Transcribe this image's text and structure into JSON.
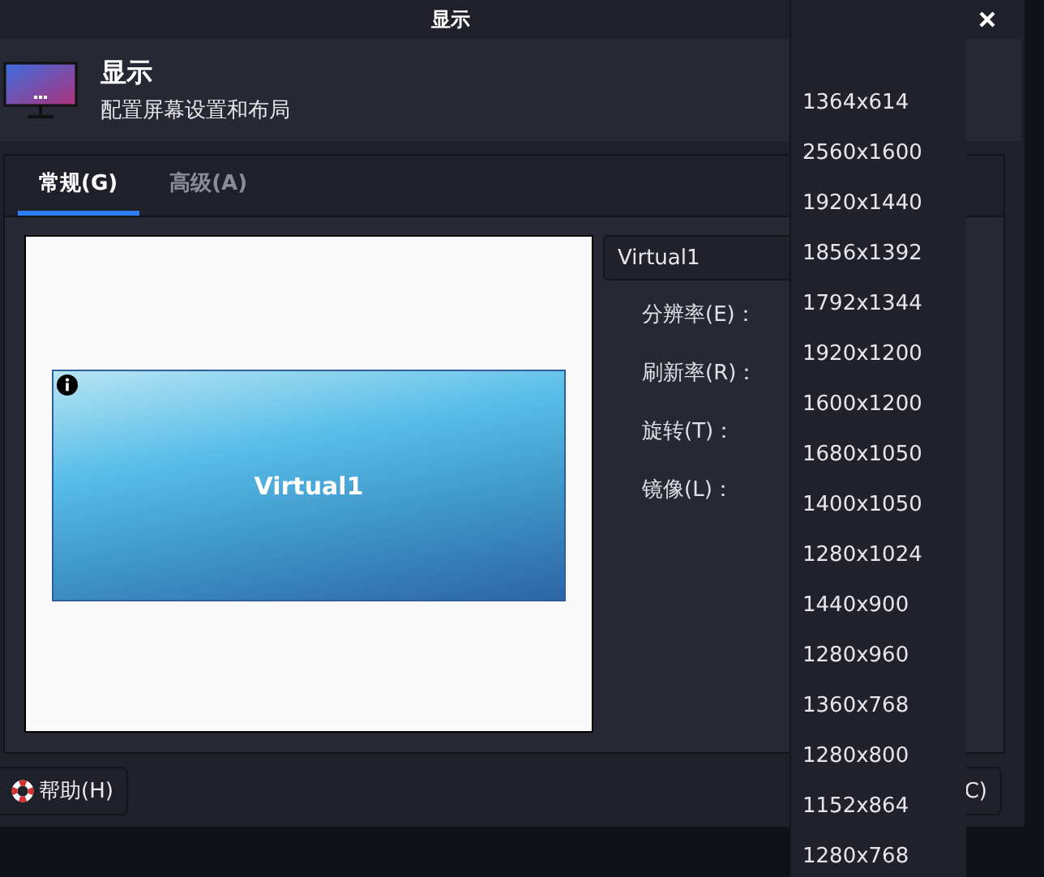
{
  "window": {
    "title": "显示"
  },
  "header": {
    "title": "显示",
    "subtitle": "配置屏幕设置和布局"
  },
  "tabs": [
    {
      "label": "常规(G)",
      "selected": true
    },
    {
      "label": "高级(A)",
      "selected": false
    }
  ],
  "preview": {
    "screen_label": "Virtual1"
  },
  "display_combo": {
    "value": "Virtual1"
  },
  "setting_labels": [
    "分辨率(E)：",
    "刷新率(R)：",
    "旋转(T)：",
    "镜像(L)："
  ],
  "buttons": [
    {
      "label": "帮助(H)",
      "kind": "help"
    },
    {
      "label": "C)",
      "kind": "plain"
    }
  ],
  "resolution_list": [
    "1364x614",
    "2560x1600",
    "1920x1440",
    "1856x1392",
    "1792x1344",
    "1920x1200",
    "1600x1200",
    "1680x1050",
    "1400x1050",
    "1280x1024",
    "1440x900",
    "1280x960",
    "1360x768",
    "1280x800",
    "1152x864",
    "1280x768"
  ]
}
